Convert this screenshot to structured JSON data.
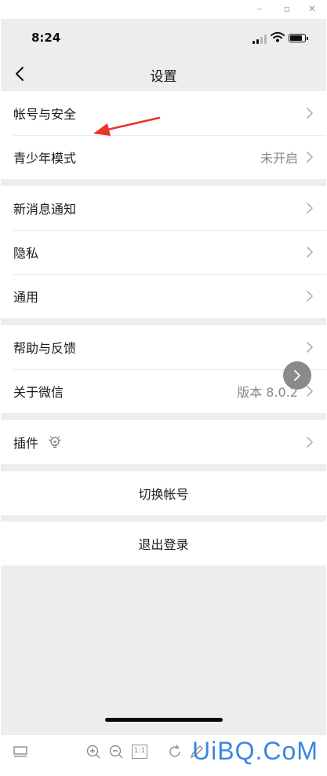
{
  "status_bar": {
    "time": "8:24",
    "battery_level": 0.85
  },
  "nav": {
    "title": "设置",
    "back_icon": "chevron-left-icon"
  },
  "groups": [
    {
      "items": [
        {
          "label": "帐号与安全",
          "value": ""
        },
        {
          "label": "青少年模式",
          "value": "未开启"
        }
      ]
    },
    {
      "items": [
        {
          "label": "新消息通知",
          "value": ""
        },
        {
          "label": "隐私",
          "value": ""
        },
        {
          "label": "通用",
          "value": ""
        }
      ]
    },
    {
      "items": [
        {
          "label": "帮助与反馈",
          "value": ""
        },
        {
          "label": "关于微信",
          "value": "版本 8.0.2"
        }
      ]
    },
    {
      "items": [
        {
          "label": "插件",
          "value": "",
          "icon": "lightbulb-icon"
        }
      ]
    }
  ],
  "actions": {
    "switch_account": "切换帐号",
    "logout": "退出登录"
  },
  "colors": {
    "background": "#ededed",
    "annotation_arrow": "#e8342a",
    "watermark": "#3a86e0"
  },
  "toolbar": {
    "icons": [
      "layout-icon",
      "zoom-in-icon",
      "zoom-out-icon",
      "actual-size-icon",
      "rotate-icon",
      "edit-icon"
    ],
    "actual_size_label": "1:1"
  },
  "watermark": "UiBQ.CoM"
}
